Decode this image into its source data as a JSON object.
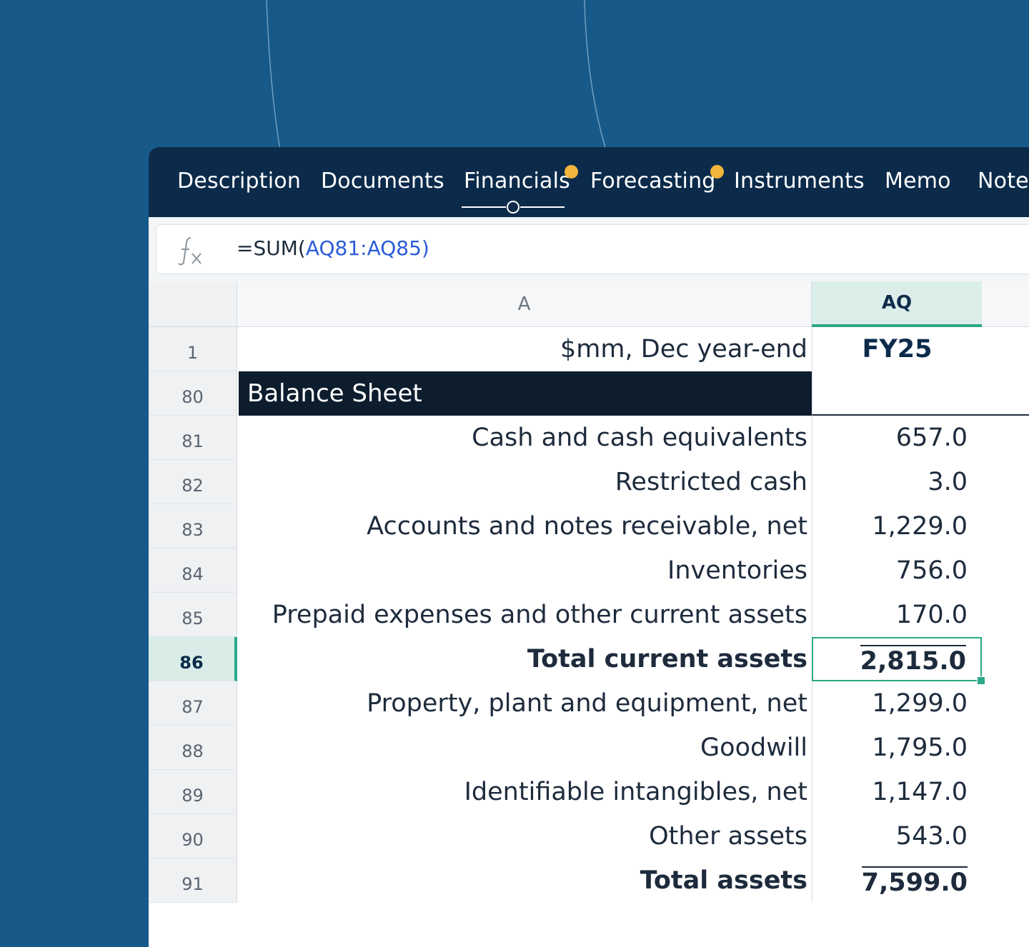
{
  "tabs": [
    {
      "label": "Description",
      "dot": false
    },
    {
      "label": "Documents",
      "dot": false
    },
    {
      "label": "Financials",
      "dot": true,
      "active": true
    },
    {
      "label": "Forecasting",
      "dot": true
    },
    {
      "label": "Instruments",
      "dot": false
    },
    {
      "label": "Memo",
      "dot": false
    },
    {
      "label": "Notes",
      "dot": false
    }
  ],
  "formula": {
    "prefix": "=SUM(",
    "range": "AQ81:AQ85",
    "suffix": ")"
  },
  "columns": {
    "a": "A",
    "aq": "AQ"
  },
  "rows": [
    {
      "num": "1",
      "label": "$mm, Dec year-end",
      "value": "FY25"
    },
    {
      "num": "80",
      "label": "Balance Sheet",
      "value": ""
    },
    {
      "num": "81",
      "label": "Cash and cash equivalents",
      "value": "657.0"
    },
    {
      "num": "82",
      "label": "Restricted cash",
      "value": "3.0"
    },
    {
      "num": "83",
      "label": "Accounts and notes receivable, net",
      "value": "1,229.0"
    },
    {
      "num": "84",
      "label": "Inventories",
      "value": "756.0"
    },
    {
      "num": "85",
      "label": "Prepaid expenses and other current assets",
      "value": "170.0"
    },
    {
      "num": "86",
      "label": "Total current assets",
      "value": "2,815.0"
    },
    {
      "num": "87",
      "label": "Property, plant and equipment, net",
      "value": "1,299.0"
    },
    {
      "num": "88",
      "label": "Goodwill",
      "value": "1,795.0"
    },
    {
      "num": "89",
      "label": "Identifiable intangibles, net",
      "value": "1,147.0"
    },
    {
      "num": "90",
      "label": "Other assets",
      "value": "543.0"
    },
    {
      "num": "91",
      "label": "Total assets",
      "value": "7,599.0"
    }
  ],
  "colors": {
    "background": "#175a8a",
    "tabbar": "#0c2b4b",
    "accent": "#2aa887",
    "dot": "#f2b43b"
  }
}
